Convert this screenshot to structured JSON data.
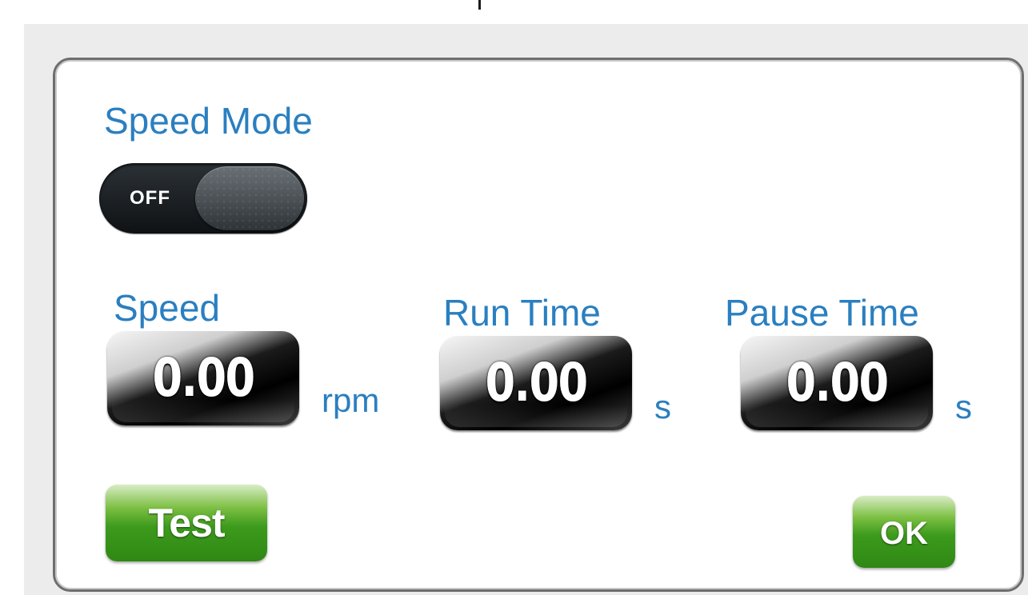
{
  "dialog": {
    "title": "Speed Mode",
    "toggle": {
      "state_label": "OFF",
      "is_on": false
    },
    "fields": [
      {
        "label": "Speed",
        "value": "0.00",
        "unit": "rpm"
      },
      {
        "label": "Run Time",
        "value": "0.00",
        "unit": "s"
      },
      {
        "label": "Pause Time",
        "value": "0.00",
        "unit": "s"
      }
    ],
    "buttons": {
      "test_label": "Test",
      "ok_label": "OK"
    }
  },
  "colors": {
    "label_blue": "#2a7fc0",
    "button_green": "#3c9a1c",
    "value_box_black": "#000000"
  }
}
